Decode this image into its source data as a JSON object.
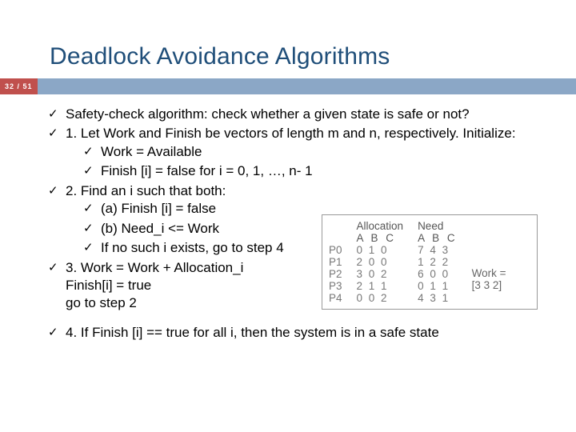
{
  "title": "Deadlock Avoidance Algorithms",
  "page": "32 / 51",
  "bullets": {
    "b1": "Safety-check algorithm: check whether a given state is safe or not?",
    "b2": "1. Let Work and Finish be vectors of length m and n, respectively. Initialize:",
    "b2a": "Work = Available",
    "b2b": "Finish [i] = false for i = 0, 1, …, n- 1",
    "b3": "2. Find an i such that both:",
    "b3a": "(a) Finish [i] = false",
    "b3b": "(b) Need_i <= Work",
    "b3c": "If no such i exists, go to step 4",
    "b4": "3.  Work = Work + Allocation_i",
    "b4cont1": "Finish[i] = true",
    "b4cont2": "go to step 2",
    "b5": "4. If Finish [i] == true for all i, then the system is in a safe state"
  },
  "table": {
    "headers": {
      "alloc": "Allocation",
      "need": "Need",
      "abc": "A B C"
    },
    "rows": [
      {
        "p": "P0",
        "alloc": "0 1 0",
        "need": "7 4 3"
      },
      {
        "p": "P1",
        "alloc": "2 0 0",
        "need": "1 2 2"
      },
      {
        "p": "P2",
        "alloc": "3 0 2",
        "need": "6 0 0"
      },
      {
        "p": "P3",
        "alloc": "2 1 1",
        "need": "0 1 1"
      },
      {
        "p": "P4",
        "alloc": "0 0 2",
        "need": "4 3 1"
      }
    ],
    "work_label": "Work =",
    "work_val": "[3 3 2]"
  }
}
